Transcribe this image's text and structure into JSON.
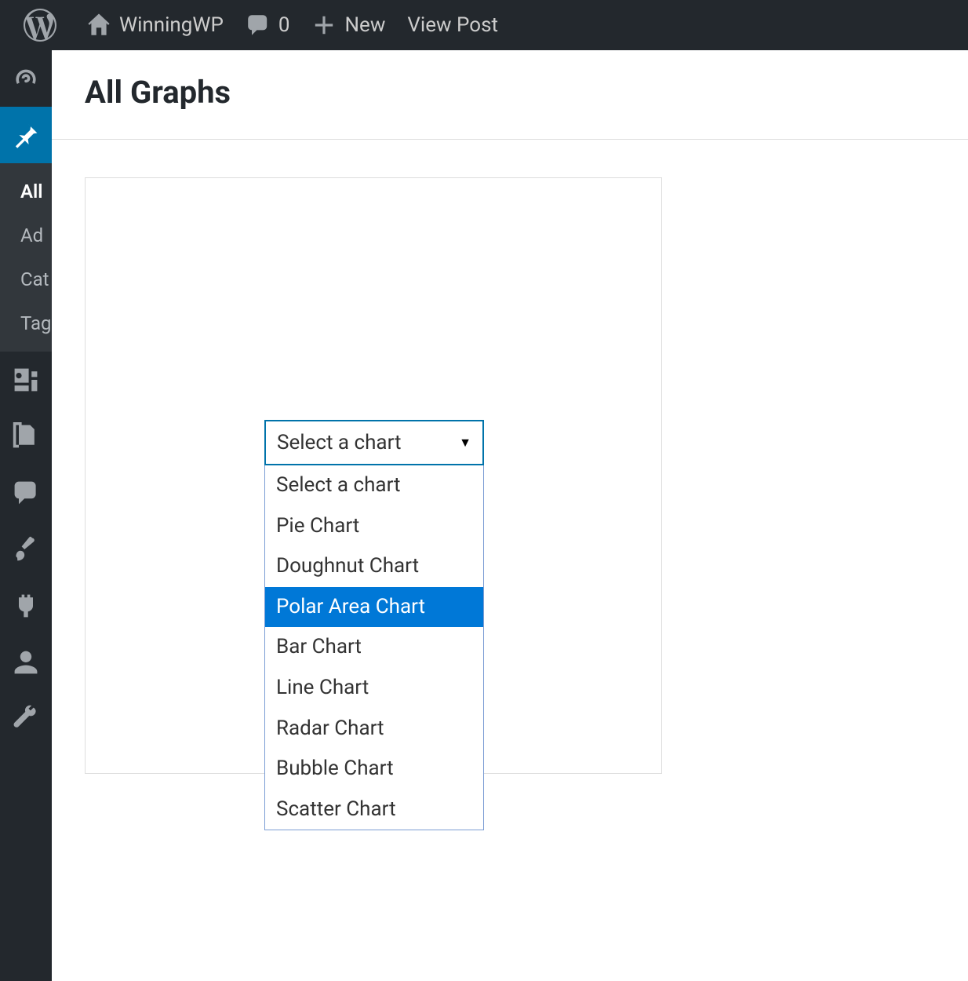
{
  "admin_bar": {
    "site_name": "WinningWP",
    "comments_count": "0",
    "new_label": "New",
    "view_post_label": "View Post"
  },
  "sidebar": {
    "submenu": {
      "items": [
        {
          "label": "All",
          "current": true
        },
        {
          "label": "Ad",
          "current": false
        },
        {
          "label": "Cat",
          "current": false
        },
        {
          "label": "Tag",
          "current": false
        }
      ]
    }
  },
  "page": {
    "title": "All Graphs"
  },
  "select": {
    "current": "Select a chart",
    "options": [
      {
        "label": "Select a chart",
        "highlighted": false
      },
      {
        "label": "Pie Chart",
        "highlighted": false
      },
      {
        "label": "Doughnut Chart",
        "highlighted": false
      },
      {
        "label": "Polar Area Chart",
        "highlighted": true
      },
      {
        "label": "Bar Chart",
        "highlighted": false
      },
      {
        "label": "Line Chart",
        "highlighted": false
      },
      {
        "label": "Radar Chart",
        "highlighted": false
      },
      {
        "label": "Bubble Chart",
        "highlighted": false
      },
      {
        "label": "Scatter Chart",
        "highlighted": false
      }
    ]
  }
}
